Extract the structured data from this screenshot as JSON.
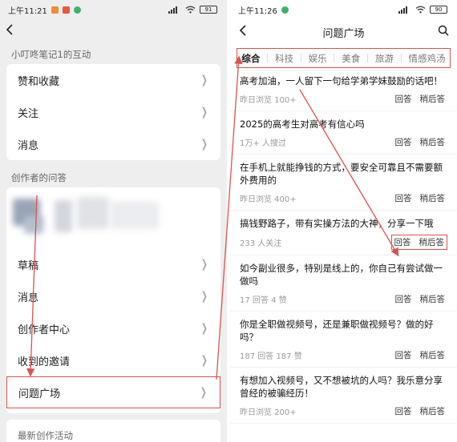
{
  "left": {
    "status": {
      "time": "上午11:21",
      "battery": "91"
    },
    "section1_title": "小叮咚笔记1的互动",
    "section1_items": [
      {
        "label": "赞和收藏"
      },
      {
        "label": "关注"
      },
      {
        "label": "消息"
      }
    ],
    "section2_title": "创作者的问答",
    "section2_items": [
      {
        "label": "草稿"
      },
      {
        "label": "消息"
      },
      {
        "label": "创作者中心"
      },
      {
        "label": "收到的邀请"
      },
      {
        "label": "问题广场"
      }
    ],
    "section3_title": "最新创作活动"
  },
  "right": {
    "status": {
      "time": "上午11:26",
      "battery": "90"
    },
    "title": "问题广场",
    "tabs": [
      "综合",
      "科技",
      "娱乐",
      "美食",
      "旅游",
      "情感鸡汤"
    ],
    "active_tab": "综合",
    "answer_label": "回答",
    "later_label": "稍后答",
    "questions": [
      {
        "title": "高考加油，一人留下一句给学弟学妹鼓励的话吧！",
        "meta": "昨日浏览 100+"
      },
      {
        "title": "2025的高考生对高考有信心吗",
        "meta": "1万+ 人搜过"
      },
      {
        "title": "在手机上就能挣钱的方式，要安全可靠且不需要额外费用的",
        "meta": "昨日浏览 400+"
      },
      {
        "title": "搞钱野路子，带有实操方法的大神，分享一下哦",
        "meta": "233 人关注"
      },
      {
        "title": "如今副业很多，特别是线上的，你自己有尝试做一做吗",
        "meta": "17 回答  4 赞"
      },
      {
        "title": "你是全职做视频号，还是兼职做视频号？做的好吗？",
        "meta": "187 回答  187 赞"
      },
      {
        "title": "有想加入视频号，又不想被坑的人吗？我乐意分享曾经的被骗经历！",
        "meta": "昨日浏览 200+"
      }
    ]
  },
  "colors": {
    "highlight": "#d9534f",
    "left_bg": "#eeeeee"
  }
}
